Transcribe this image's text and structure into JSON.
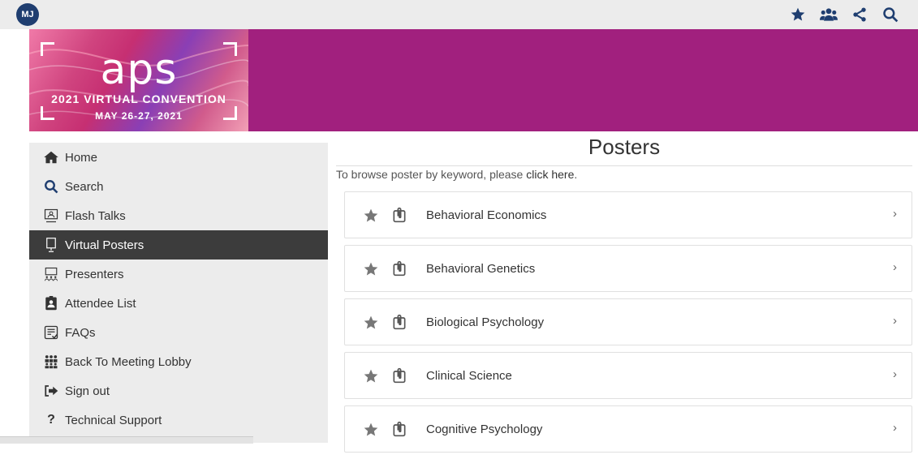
{
  "user": {
    "initials": "MJ"
  },
  "topbar": {
    "icons": [
      "star-icon",
      "group-icon",
      "share-icon",
      "search-icon"
    ]
  },
  "banner": {
    "logo_text": "aps",
    "line1": "2021 VIRTUAL CONVENTION",
    "line2": "MAY 26-27, 2021",
    "background": "#a1207e"
  },
  "sidebar": {
    "items": [
      {
        "label": "Home",
        "icon": "home-icon"
      },
      {
        "label": "Search",
        "icon": "search-icon"
      },
      {
        "label": "Flash Talks",
        "icon": "presenter-icon"
      },
      {
        "label": "Virtual Posters",
        "icon": "poster-board-icon",
        "active": true
      },
      {
        "label": "Presenters",
        "icon": "presenters-icon"
      },
      {
        "label": "Attendee List",
        "icon": "badge-icon"
      },
      {
        "label": "FAQs",
        "icon": "faq-icon"
      },
      {
        "label": "Back To Meeting Lobby",
        "icon": "lobby-icon"
      },
      {
        "label": "Sign out",
        "icon": "sign-out-icon"
      },
      {
        "label": "Technical Support",
        "icon": "question-icon"
      }
    ]
  },
  "main": {
    "title": "Posters",
    "browse_text": "To browse poster by keyword, please ",
    "browse_link": "click here",
    "browse_end": ".",
    "posters": [
      {
        "label": "Behavioral Economics"
      },
      {
        "label": "Behavioral Genetics"
      },
      {
        "label": "Biological Psychology"
      },
      {
        "label": "Clinical Science"
      },
      {
        "label": "Cognitive Psychology"
      }
    ],
    "chevron": "›"
  },
  "colors": {
    "accent": "#a1207e",
    "avatar": "#1f3e70",
    "active_nav": "#3c3c3c",
    "navy_icon": "#1f3e70"
  }
}
